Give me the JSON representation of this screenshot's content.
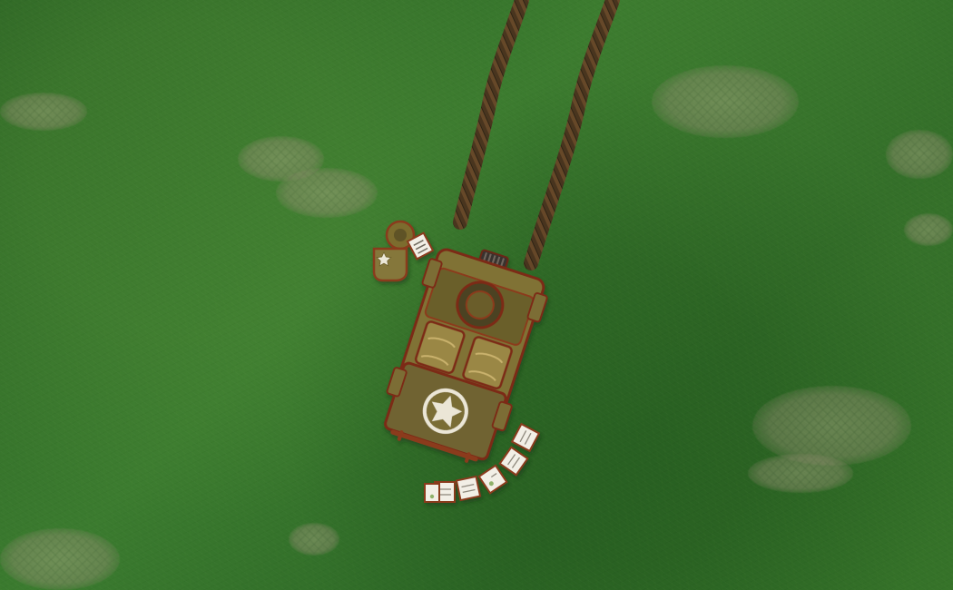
{
  "scene": {
    "type": "top-down military game view",
    "terrain": "grass",
    "accent_colors": {
      "grass": "#2f6b26",
      "vehicle": "#7d6f2f",
      "vehicle_dark": "#5f5324",
      "outline": "#7b2a16",
      "mud": "#5a3a20",
      "ammo": "#f2efe6"
    }
  },
  "objects": {
    "vehicle": {
      "name": "jeep",
      "marking_icon": "white-star-icon"
    },
    "soldier": {
      "name": "soldier",
      "marking_icon": "star-icon"
    },
    "ammo_belt": {
      "name": "ammo-belt",
      "items": 6
    }
  }
}
